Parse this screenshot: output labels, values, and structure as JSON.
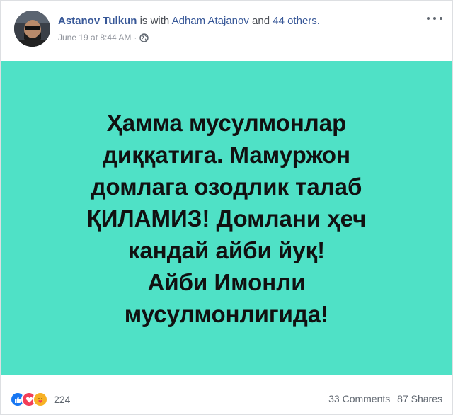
{
  "post": {
    "author": "Astanov Tulkun",
    "with_text": "is with",
    "tagged_person": "Adham Atajanov",
    "and_text": "and",
    "others": "44 others.",
    "timestamp": "June 19 at 8:44 AM",
    "separator": "·",
    "privacy_icon": "globe-icon",
    "more_icon": "more-options-icon"
  },
  "panel": {
    "background": "#4fe1c6",
    "lines": [
      "Ҳамма мусулмонлар",
      "диққатига. Мамуржон",
      "домлага озодлик талаб",
      "ҚИЛАМИЗ! Домлани ҳеч",
      "кандай айби йуқ!",
      "Айби Имонли",
      "мусулмонлигида!"
    ]
  },
  "footer": {
    "reaction_icons": [
      "like-icon",
      "love-icon",
      "care-icon"
    ],
    "reaction_count": "224",
    "comments": "33 Comments",
    "shares": "87 Shares"
  },
  "colors": {
    "link": "#385898",
    "meta": "#90949c",
    "like": "#1877f2",
    "love": "#f33e58",
    "care": "#f7b125"
  }
}
